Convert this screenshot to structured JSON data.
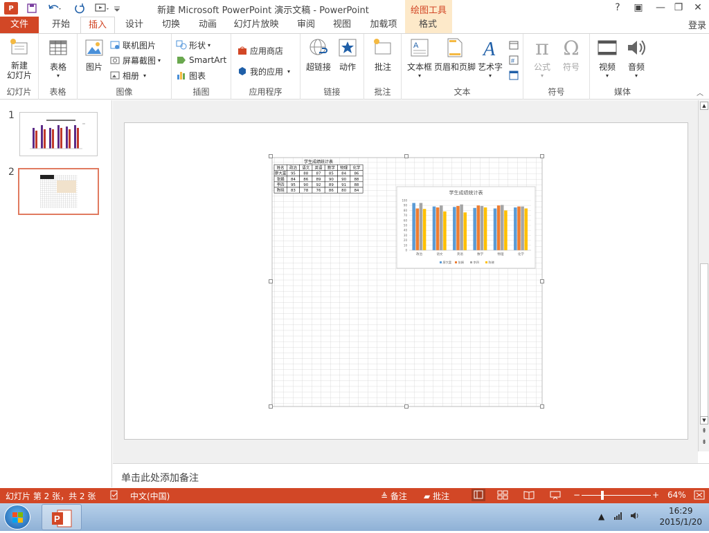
{
  "app": {
    "logo_text": "P",
    "window_title": "新建 Microsoft PowerPoint 演示文稿 - PowerPoint",
    "context_tab_group": "绘图工具",
    "login": "登录",
    "help": "?",
    "window_controls": [
      "?",
      "▣",
      "—",
      "❐",
      "✕"
    ]
  },
  "tabs": [
    {
      "label": "文件"
    },
    {
      "label": "开始"
    },
    {
      "label": "插入"
    },
    {
      "label": "设计"
    },
    {
      "label": "切换"
    },
    {
      "label": "动画"
    },
    {
      "label": "幻灯片放映"
    },
    {
      "label": "审阅"
    },
    {
      "label": "视图"
    },
    {
      "label": "加载项"
    },
    {
      "label": "格式"
    }
  ],
  "ribbon": {
    "groups": {
      "slides": {
        "label": "幻灯片",
        "new_slide": "新建\n幻灯片"
      },
      "tables": {
        "label": "表格",
        "table": "表格"
      },
      "images": {
        "label": "图像",
        "picture": "图片",
        "online_picture": "联机图片",
        "screenshot": "屏幕截图",
        "album": "相册"
      },
      "illustrations": {
        "label": "插图",
        "shapes": "形状",
        "smartart": "SmartArt",
        "chart": "图表"
      },
      "apps": {
        "label": "应用程序",
        "store": "应用商店",
        "my_apps": "我的应用"
      },
      "links": {
        "label": "链接",
        "hyperlink": "超链接",
        "action": "动作"
      },
      "comments": {
        "label": "批注",
        "comment": "批注"
      },
      "text": {
        "label": "文本",
        "textbox": "文本框",
        "header_footer": "页眉和页脚",
        "wordart": "艺术字"
      },
      "symbols": {
        "label": "符号",
        "equation": "公式",
        "symbol": "符号"
      },
      "media": {
        "label": "媒体",
        "video": "视频",
        "audio": "音频"
      }
    }
  },
  "slides_pane": {
    "thumbnails": [
      {
        "number": "1"
      },
      {
        "number": "2"
      }
    ]
  },
  "slide": {
    "table": {
      "title": "学生成绩统计表",
      "headers": [
        "姓名",
        "政治",
        "语文",
        "英语",
        "数学",
        "物理",
        "化学"
      ],
      "rows": [
        [
          "廖大富",
          "95",
          "88",
          "87",
          "85",
          "84",
          "86"
        ],
        [
          "张娟",
          "84",
          "86",
          "89",
          "90",
          "90",
          "88"
        ],
        [
          "李四",
          "95",
          "90",
          "92",
          "89",
          "91",
          "88"
        ],
        [
          "陈晓",
          "83",
          "78",
          "76",
          "86",
          "80",
          "84"
        ]
      ]
    }
  },
  "chart_data": {
    "type": "bar",
    "title": "学生成绩统计表",
    "categories": [
      "政治",
      "语文",
      "英语",
      "数学",
      "物理",
      "化学"
    ],
    "series": [
      {
        "name": "廖大富",
        "values": [
          95,
          88,
          87,
          85,
          84,
          86
        ],
        "color": "#5b9bd5"
      },
      {
        "name": "张娟",
        "values": [
          84,
          86,
          89,
          90,
          90,
          88
        ],
        "color": "#ed7d31"
      },
      {
        "name": "李四",
        "values": [
          95,
          90,
          92,
          89,
          91,
          88
        ],
        "color": "#a5a5a5"
      },
      {
        "name": "陈晓",
        "values": [
          83,
          78,
          76,
          86,
          80,
          84
        ],
        "color": "#ffc000"
      }
    ],
    "ylim": [
      0,
      100
    ],
    "yticks": [
      "0",
      "10",
      "20",
      "30",
      "40",
      "50",
      "60",
      "70",
      "80",
      "90",
      "100"
    ],
    "legend": "bottom",
    "grid": true
  },
  "notes": {
    "placeholder": "单击此处添加备注"
  },
  "status": {
    "slide_info": "幻灯片 第 2 张，共 2 张",
    "language": "中文(中国)",
    "notes_btn": "备注",
    "comments_btn": "批注",
    "zoom": "64%",
    "zoom_level": 0.64
  },
  "taskbar": {
    "time": "16:29",
    "date": "2015/1/20"
  },
  "colors": {
    "accent": "#d24726",
    "context_tab": "#fde9c9"
  }
}
